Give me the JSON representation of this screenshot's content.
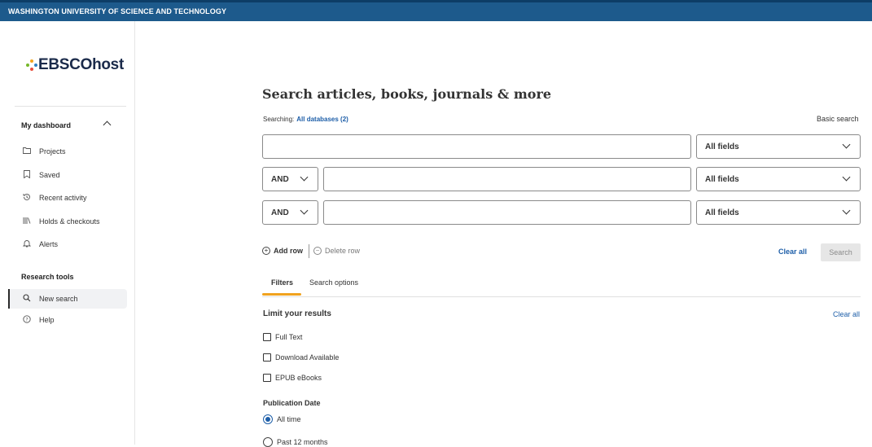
{
  "banner": {
    "institution": "WASHINGTON UNIVERSITY OF SCIENCE AND TECHNOLOGY"
  },
  "logo": {
    "text": "EBSCOhost"
  },
  "sidebar": {
    "dashboard_title": "My dashboard",
    "dashboard_items": [
      {
        "label": "Projects",
        "icon": "folder-icon"
      },
      {
        "label": "Saved",
        "icon": "bookmark-icon"
      },
      {
        "label": "Recent activity",
        "icon": "history-icon"
      },
      {
        "label": "Holds & checkouts",
        "icon": "books-icon"
      },
      {
        "label": "Alerts",
        "icon": "bell-icon"
      }
    ],
    "research_title": "Research tools",
    "research_items": [
      {
        "label": "New search",
        "icon": "search-icon",
        "active": true
      },
      {
        "label": "Help",
        "icon": "help-icon"
      }
    ]
  },
  "search": {
    "title": "Search articles, books, journals & more",
    "searching_label": "Searching:",
    "databases_link": "All databases (2)",
    "basic_search": "Basic search",
    "rows": [
      {
        "operator": null,
        "value": "",
        "field": "All fields"
      },
      {
        "operator": "AND",
        "value": "",
        "field": "All fields"
      },
      {
        "operator": "AND",
        "value": "",
        "field": "All fields"
      }
    ],
    "add_row": "Add row",
    "delete_row": "Delete row",
    "clear_all": "Clear all",
    "search_button": "Search"
  },
  "tabs": [
    {
      "label": "Filters",
      "active": true
    },
    {
      "label": "Search options",
      "active": false
    }
  ],
  "filters": {
    "limit_title": "Limit your results",
    "clear_all": "Clear all",
    "checkboxes": [
      {
        "label": "Full Text",
        "checked": false
      },
      {
        "label": "Download Available",
        "checked": false
      },
      {
        "label": "EPUB eBooks",
        "checked": false
      }
    ],
    "publication_date_title": "Publication Date",
    "date_options": [
      {
        "label": "All time",
        "selected": true
      },
      {
        "label": "Past 12 months",
        "selected": false
      }
    ]
  },
  "colors": {
    "banner": "#1d5a8c",
    "link": "#1d5ea8",
    "tab_accent": "#f0a21e"
  }
}
